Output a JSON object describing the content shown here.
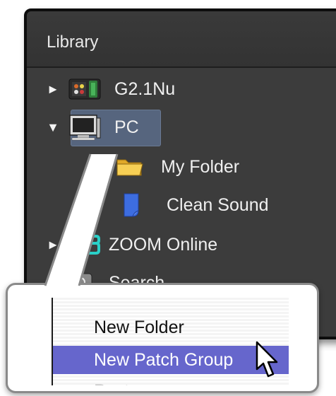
{
  "library": {
    "title": "Library",
    "items": [
      {
        "label": "G2.1Nu",
        "icon": "effects-device-icon",
        "arrow": "►"
      },
      {
        "label": "PC",
        "icon": "computer-icon",
        "arrow": "▼"
      },
      {
        "label": "My Folder",
        "icon": "folder-icon",
        "arrow": "►"
      },
      {
        "label": "Clean Sound",
        "icon": "patch-file-icon",
        "arrow": ""
      },
      {
        "label": "ZOOM Online",
        "icon": "zoom-logo-icon",
        "arrow": "►"
      },
      {
        "label": "Search",
        "icon": "search-icon",
        "arrow": ""
      }
    ]
  },
  "context_menu": {
    "items": [
      {
        "label": "New Folder",
        "state": "normal"
      },
      {
        "label": "New Patch Group",
        "state": "selected"
      },
      {
        "label": "Paste",
        "state": "disabled"
      }
    ]
  },
  "colors": {
    "panel_bg": "#3c3c3c",
    "selection_bg": "#56657e",
    "menu_highlight": "#6666cc"
  }
}
